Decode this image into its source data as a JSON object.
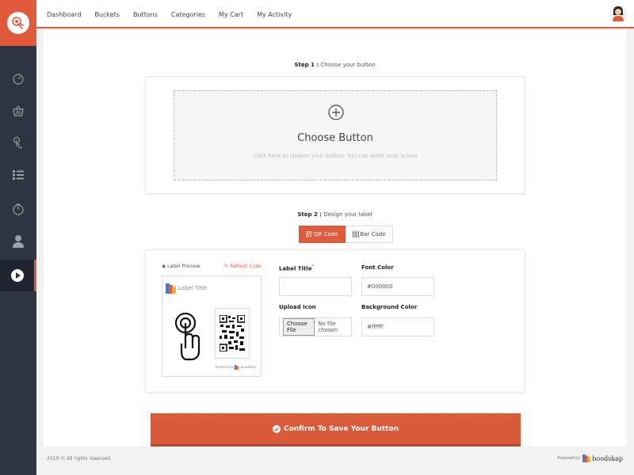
{
  "topnav": {
    "items": [
      "Dashboard",
      "Buckets",
      "Buttons",
      "Categories",
      "My Cart",
      "My Activity"
    ]
  },
  "sidebar": {
    "icons": [
      "dashboard-icon",
      "basket-icon",
      "touch-icon",
      "list-icon",
      "timer-icon",
      "user-icon",
      "play-icon"
    ],
    "active_index": 6
  },
  "step1": {
    "label_bold": "Step 1 :",
    "label_text": "Choose your button",
    "choose_title": "Choose Button",
    "choose_sub": "Click here to choose your button. You can write your action"
  },
  "step2": {
    "label_bold": "Step 2 :",
    "label_text": "Design your label",
    "tabs": [
      "QR Code",
      "Bar Code"
    ],
    "active_tab": "QR Code"
  },
  "preview": {
    "head_label": "Label Preview",
    "refresh_label": "Refresh Code",
    "label_title": "Label Title",
    "powered_by": "Powered by",
    "brand": "boodskap"
  },
  "form": {
    "label_title_label": "Label Title",
    "label_title_required": "*",
    "label_title_value": "",
    "font_color_label": "Font Color",
    "font_color_value": "#000000",
    "upload_icon_label": "Upload Icon",
    "choose_file_label": "Choose File",
    "no_file_label": "No file chosen",
    "bg_color_label": "Background Color",
    "bg_color_value": "#ffffff"
  },
  "confirm_button": "Confirm To Save Your Button",
  "footer": {
    "copyright": "2019 © All rights reserved.",
    "powered_by": "Powered by",
    "brand": "boodskap"
  },
  "colors": {
    "accent": "#e05a3c",
    "sidebar": "#2f3540"
  }
}
